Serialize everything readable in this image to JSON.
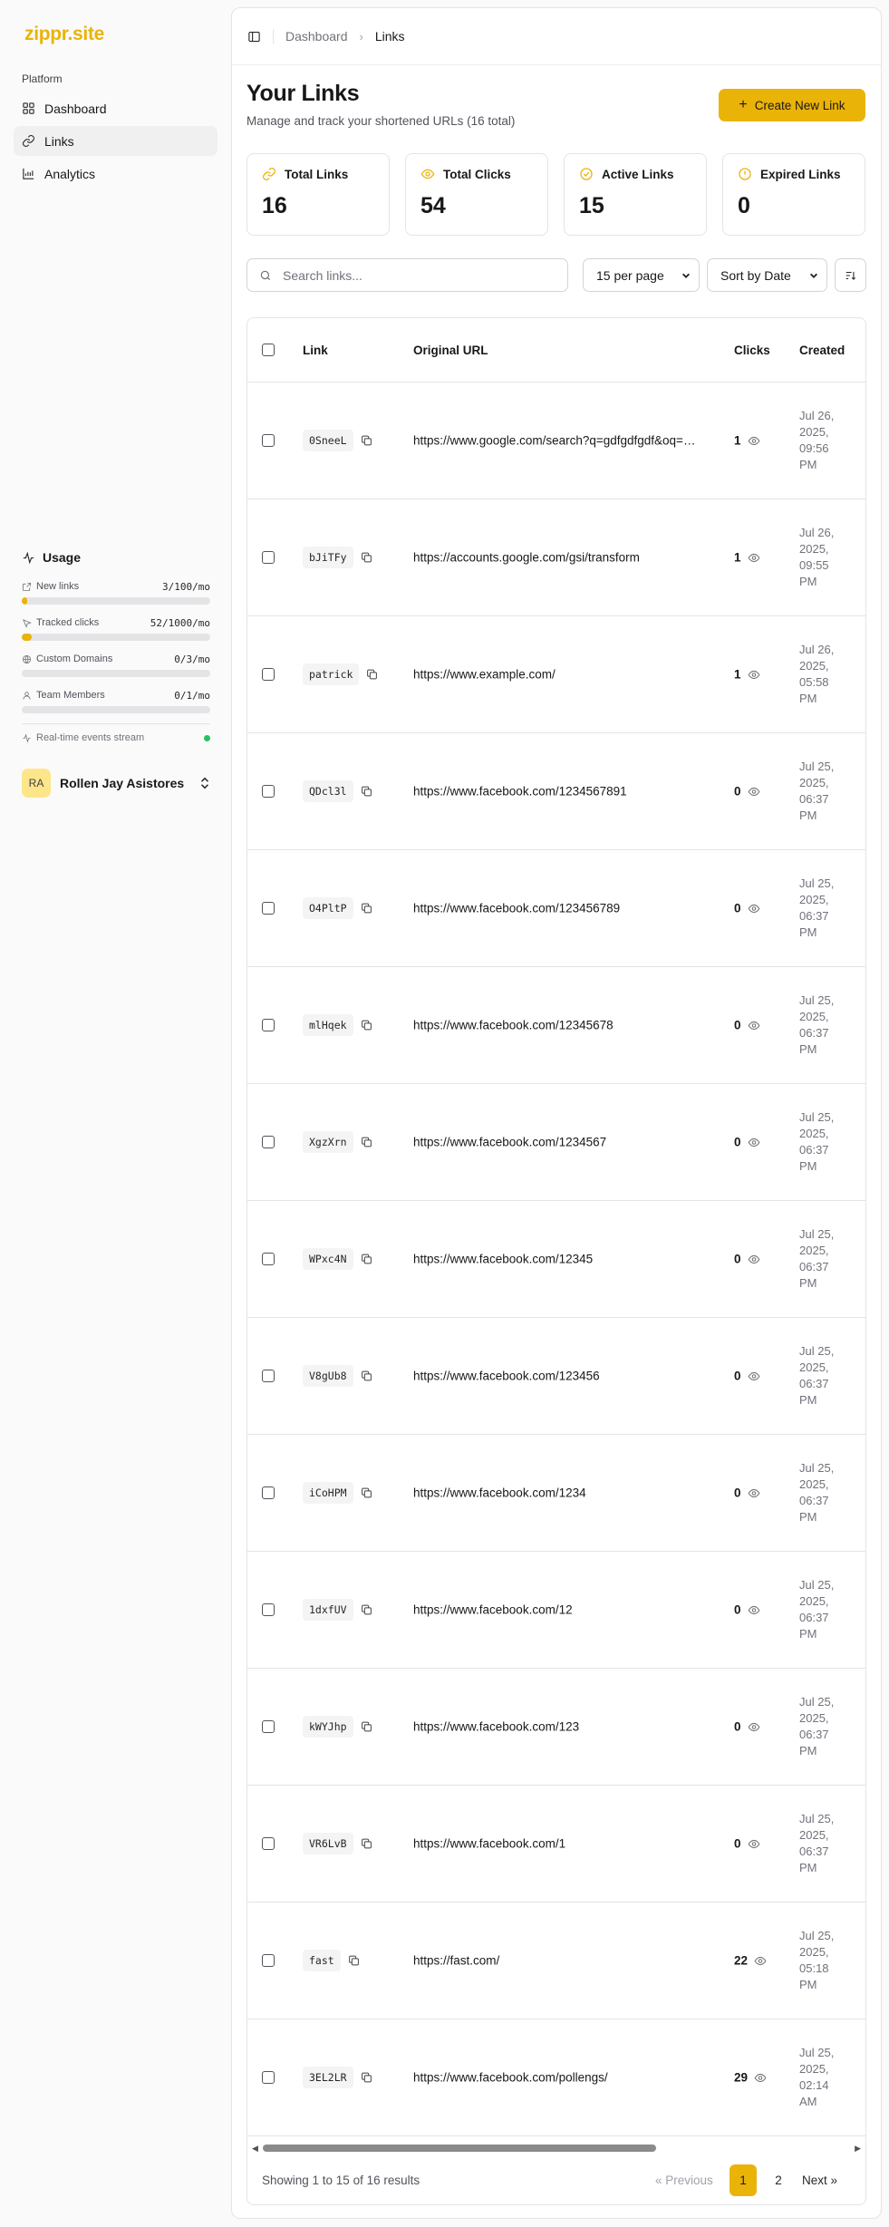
{
  "brand": "zippr.site",
  "sidebar": {
    "group_label": "Platform",
    "items": [
      {
        "label": "Dashboard",
        "icon": "dashboard-grid-icon"
      },
      {
        "label": "Links",
        "icon": "link-icon",
        "active": true
      },
      {
        "label": "Analytics",
        "icon": "chart-icon"
      }
    ],
    "usage": {
      "title": "Usage",
      "rows": [
        {
          "label": "New links",
          "value": "3/100/mo",
          "fraction": 0.03
        },
        {
          "label": "Tracked clicks",
          "value": "52/1000/mo",
          "fraction": 0.052
        },
        {
          "label": "Custom Domains",
          "value": "0/3/mo",
          "fraction": 0
        },
        {
          "label": "Team Members",
          "value": "0/1/mo",
          "fraction": 0
        }
      ],
      "stream_label": "Real-time events stream"
    },
    "user": {
      "initials": "RA",
      "name": "Rollen Jay Asistores"
    }
  },
  "breadcrumb": {
    "parent": "Dashboard",
    "current": "Links"
  },
  "page": {
    "title": "Your Links",
    "subtitle": "Manage and track your shortened URLs (16 total)",
    "create_label": "Create New Link"
  },
  "stats": [
    {
      "label": "Total Links",
      "value": "16",
      "icon": "link-icon"
    },
    {
      "label": "Total Clicks",
      "value": "54",
      "icon": "eye-icon"
    },
    {
      "label": "Active Links",
      "value": "15",
      "icon": "check-circle-icon"
    },
    {
      "label": "Expired Links",
      "value": "0",
      "icon": "alert-circle-icon"
    }
  ],
  "toolbar": {
    "search_placeholder": "Search links...",
    "per_page": "15 per page",
    "sort": "Sort by Date"
  },
  "table": {
    "columns": {
      "link": "Link",
      "url": "Original URL",
      "clicks": "Clicks",
      "created": "Created"
    },
    "rows": [
      {
        "slug": "0SneeL",
        "url": "https://www.google.com/search?q=gdfgdfgdf&oq=gdfgdfgdf",
        "clicks": "1",
        "created": [
          "Jul 26,",
          "2025,",
          "09:56",
          "PM"
        ]
      },
      {
        "slug": "bJiTFy",
        "url": "https://accounts.google.com/gsi/transform",
        "clicks": "1",
        "created": [
          "Jul 26,",
          "2025,",
          "09:55",
          "PM"
        ]
      },
      {
        "slug": "patrick",
        "url": "https://www.example.com/",
        "clicks": "1",
        "created": [
          "Jul 26,",
          "2025,",
          "05:58",
          "PM"
        ]
      },
      {
        "slug": "QDcl3l",
        "url": "https://www.facebook.com/1234567891",
        "clicks": "0",
        "created": [
          "Jul 25,",
          "2025,",
          "06:37",
          "PM"
        ]
      },
      {
        "slug": "O4PltP",
        "url": "https://www.facebook.com/123456789",
        "clicks": "0",
        "created": [
          "Jul 25,",
          "2025,",
          "06:37",
          "PM"
        ]
      },
      {
        "slug": "mlHqek",
        "url": "https://www.facebook.com/12345678",
        "clicks": "0",
        "created": [
          "Jul 25,",
          "2025,",
          "06:37",
          "PM"
        ]
      },
      {
        "slug": "XgzXrn",
        "url": "https://www.facebook.com/1234567",
        "clicks": "0",
        "created": [
          "Jul 25,",
          "2025,",
          "06:37",
          "PM"
        ]
      },
      {
        "slug": "WPxc4N",
        "url": "https://www.facebook.com/12345",
        "clicks": "0",
        "created": [
          "Jul 25,",
          "2025,",
          "06:37",
          "PM"
        ]
      },
      {
        "slug": "V8gUb8",
        "url": "https://www.facebook.com/123456",
        "clicks": "0",
        "created": [
          "Jul 25,",
          "2025,",
          "06:37",
          "PM"
        ]
      },
      {
        "slug": "iCoHPM",
        "url": "https://www.facebook.com/1234",
        "clicks": "0",
        "created": [
          "Jul 25,",
          "2025,",
          "06:37",
          "PM"
        ]
      },
      {
        "slug": "1dxfUV",
        "url": "https://www.facebook.com/12",
        "clicks": "0",
        "created": [
          "Jul 25,",
          "2025,",
          "06:37",
          "PM"
        ]
      },
      {
        "slug": "kWYJhp",
        "url": "https://www.facebook.com/123",
        "clicks": "0",
        "created": [
          "Jul 25,",
          "2025,",
          "06:37",
          "PM"
        ]
      },
      {
        "slug": "VR6LvB",
        "url": "https://www.facebook.com/1",
        "clicks": "0",
        "created": [
          "Jul 25,",
          "2025,",
          "06:37",
          "PM"
        ]
      },
      {
        "slug": "fast",
        "url": "https://fast.com/",
        "clicks": "22",
        "created": [
          "Jul 25,",
          "2025,",
          "05:18",
          "PM"
        ]
      },
      {
        "slug": "3EL2LR",
        "url": "https://www.facebook.com/pollengs/",
        "clicks": "29",
        "created": [
          "Jul 25,",
          "2025,",
          "02:14",
          "AM"
        ]
      }
    ]
  },
  "pagination": {
    "summary": "Showing 1 to 15 of 16 results",
    "prev": "« Previous",
    "pages": [
      "1",
      "2"
    ],
    "current": "1",
    "next": "Next »"
  },
  "colors": {
    "accent": "#eab308",
    "active_dot": "#22c55e"
  }
}
